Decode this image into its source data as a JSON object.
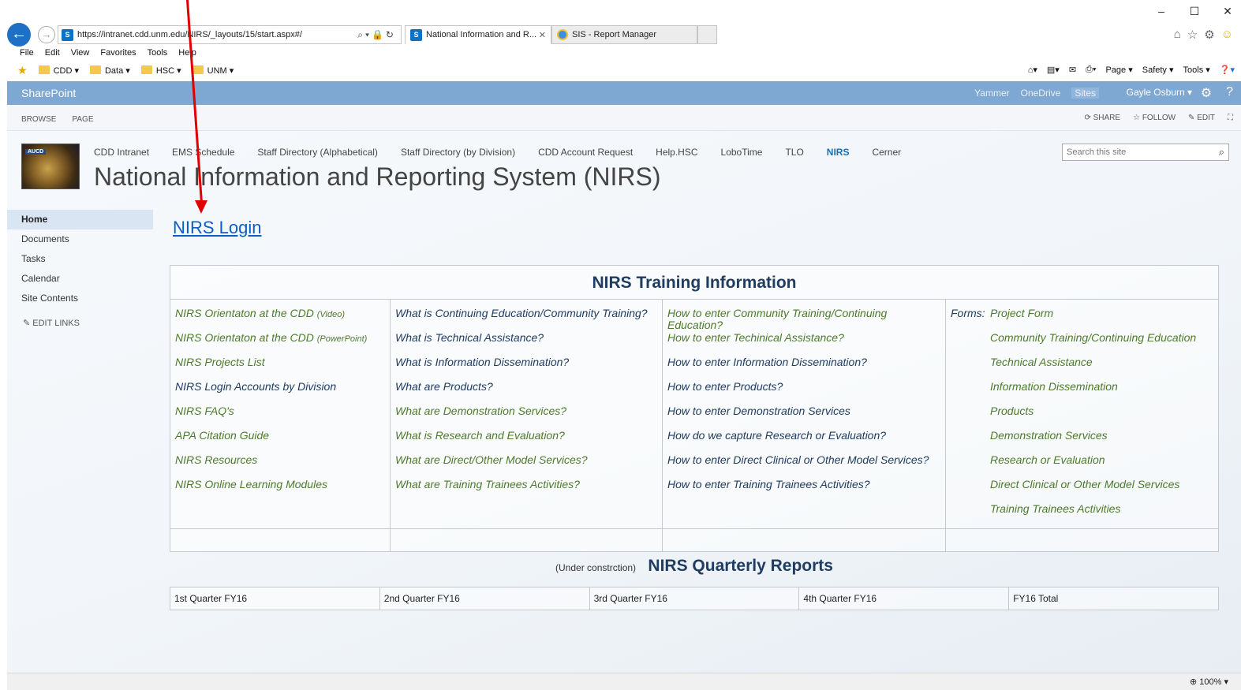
{
  "browser": {
    "url": "https://intranet.cdd.unm.edu/NIRS/_layouts/15/start.aspx#/",
    "tabs": [
      {
        "label": "National Information and R..."
      },
      {
        "label": "SIS - Report Manager"
      }
    ],
    "menu": [
      "File",
      "Edit",
      "View",
      "Favorites",
      "Tools",
      "Help"
    ],
    "favorites": [
      "CDD ▾",
      "Data ▾",
      "HSC ▾",
      "UNM ▾"
    ],
    "commands": [
      "Page ▾",
      "Safety ▾",
      "Tools ▾"
    ],
    "zoom": "100%"
  },
  "suitebar": {
    "brand": "SharePoint",
    "links": [
      "Yammer",
      "OneDrive",
      "Sites"
    ],
    "user": "Gayle Osburn ▾"
  },
  "ribbon": {
    "tabs": [
      "BROWSE",
      "PAGE"
    ],
    "actions": [
      "SHARE",
      "FOLLOW",
      "EDIT"
    ]
  },
  "site": {
    "logo_text": "AUCD",
    "title": "National Information and Reporting System (NIRS)",
    "search_placeholder": "Search this site",
    "topnav": [
      "CDD Intranet",
      "EMS Schedule",
      "Staff Directory (Alphabetical)",
      "Staff Directory (by Division)",
      "CDD Account Request",
      "Help.HSC",
      "LoboTime",
      "TLO",
      "NIRS",
      "Cerner"
    ]
  },
  "quicklaunch": {
    "items": [
      "Home",
      "Documents",
      "Tasks",
      "Calendar",
      "Site Contents"
    ],
    "edit_links": "EDIT LINKS"
  },
  "main": {
    "login_link": "NIRS Login",
    "training": {
      "title": "NIRS Training Information",
      "col1": [
        {
          "text": "NIRS Orientaton at the CDD",
          "suffix": "(Video)",
          "color": "green"
        },
        {
          "text": "NIRS Orientaton at the CDD",
          "suffix": "(PowerPoint)",
          "color": "green"
        },
        {
          "text": "NIRS Projects List",
          "color": "green"
        },
        {
          "text": "NIRS Login Accounts by Division",
          "color": "navy"
        },
        {
          "text": "NIRS FAQ's",
          "color": "green"
        },
        {
          "text": "APA Citation Guide",
          "color": "green"
        },
        {
          "text": "NIRS Resources",
          "color": "green"
        },
        {
          "text": "NIRS Online Learning Modules",
          "color": "green"
        }
      ],
      "col2": [
        {
          "text": "What is Continuing Education/Community Training?",
          "color": "navy"
        },
        {
          "text": "What is Technical Assistance?",
          "color": "navy"
        },
        {
          "text": "What is Information Dissemination?",
          "color": "navy"
        },
        {
          "text": "What are Products?",
          "color": "navy"
        },
        {
          "text": "What are Demonstration Services?",
          "color": "green"
        },
        {
          "text": "What is Research and Evaluation?",
          "color": "green"
        },
        {
          "text": "What are Direct/Other Model Services?",
          "color": "green"
        },
        {
          "text": "What are Training Trainees Activities?",
          "color": "green"
        }
      ],
      "col3": [
        {
          "text": "How to enter Community Training/Continuing Education?",
          "color": "green"
        },
        {
          "text": "How to enter Techinical Assistance?",
          "color": "green"
        },
        {
          "text": "How to enter Information Dissemination?",
          "color": "navy"
        },
        {
          "text": "How to enter Products?",
          "color": "navy"
        },
        {
          "text": "How to enter Demonstration Services",
          "color": "navy"
        },
        {
          "text": "How do we capture Research or Evaluation?",
          "color": "navy"
        },
        {
          "text": "How to enter Direct Clinical or Other Model Services?",
          "color": "navy"
        },
        {
          "text": "How to enter Training Trainees Activities?",
          "color": "navy"
        }
      ],
      "forms_label": "Forms:",
      "col4": [
        {
          "text": "Project Form",
          "color": "green"
        },
        {
          "text": "Community Training/Continuing Education",
          "color": "green"
        },
        {
          "text": "Technical Assistance",
          "color": "green"
        },
        {
          "text": "Information Dissemination",
          "color": "green"
        },
        {
          "text": "Products",
          "color": "green"
        },
        {
          "text": "Demonstration Services",
          "color": "green"
        },
        {
          "text": "Research or Evaluation",
          "color": "green"
        },
        {
          "text": "Direct Clinical or Other Model Services",
          "color": "green"
        },
        {
          "text": "Training Trainees Activities",
          "color": "green"
        }
      ]
    },
    "quarterly": {
      "note": "(Under constrction)",
      "title": "NIRS Quarterly Reports",
      "cells": [
        "1st Quarter FY16",
        "2nd Quarter FY16",
        "3rd Quarter FY16",
        "4th Quarter FY16",
        "FY16 Total"
      ]
    }
  },
  "colors": {
    "suitebar": "#7ea7d1",
    "link_green": "#4d7a2b",
    "link_navy": "#1f3c61",
    "login_blue": "#0c5ec7",
    "annotation_arrow": "#e00000"
  }
}
